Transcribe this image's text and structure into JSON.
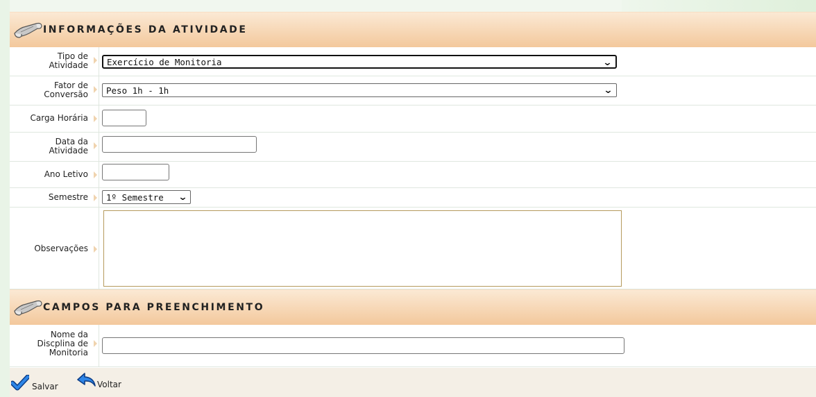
{
  "sections": {
    "info_title": "INFORMAÇÕES DA ATIVIDADE",
    "fields_title": "CAMPOS PARA PREENCHIMENTO"
  },
  "fields": {
    "tipo": {
      "label_line1": "Tipo de",
      "label_line2": "Atividade",
      "value": "Exercício de Monitoria"
    },
    "fator": {
      "label_line1": "Fator de",
      "label_line2": "Conversão",
      "value": "Peso 1h - 1h"
    },
    "carga": {
      "label": "Carga Horária",
      "value": ""
    },
    "data": {
      "label_line1": "Data da",
      "label_line2": "Atividade",
      "value": ""
    },
    "ano": {
      "label": "Ano Letivo",
      "value": ""
    },
    "semestre": {
      "label": "Semestre",
      "value": "1º Semestre"
    },
    "observacoes": {
      "label": "Observações",
      "value": ""
    },
    "disciplina": {
      "label_line1": "Nome da",
      "label_line2": "Discplina de",
      "label_line3": "Monitoria",
      "value": ""
    }
  },
  "actions": {
    "save_label": "Salvar",
    "back_label": "Voltar"
  },
  "icons": {
    "section": "scroll-icon",
    "save": "checkmark-icon",
    "back": "back-arrow-icon"
  },
  "colors": {
    "header_top": "#fbe9d4",
    "header_bottom": "#f3c89c",
    "label_arrow": "#f0d3ae",
    "save_icon": "#1e6fd6",
    "back_icon": "#1e6fd6"
  }
}
